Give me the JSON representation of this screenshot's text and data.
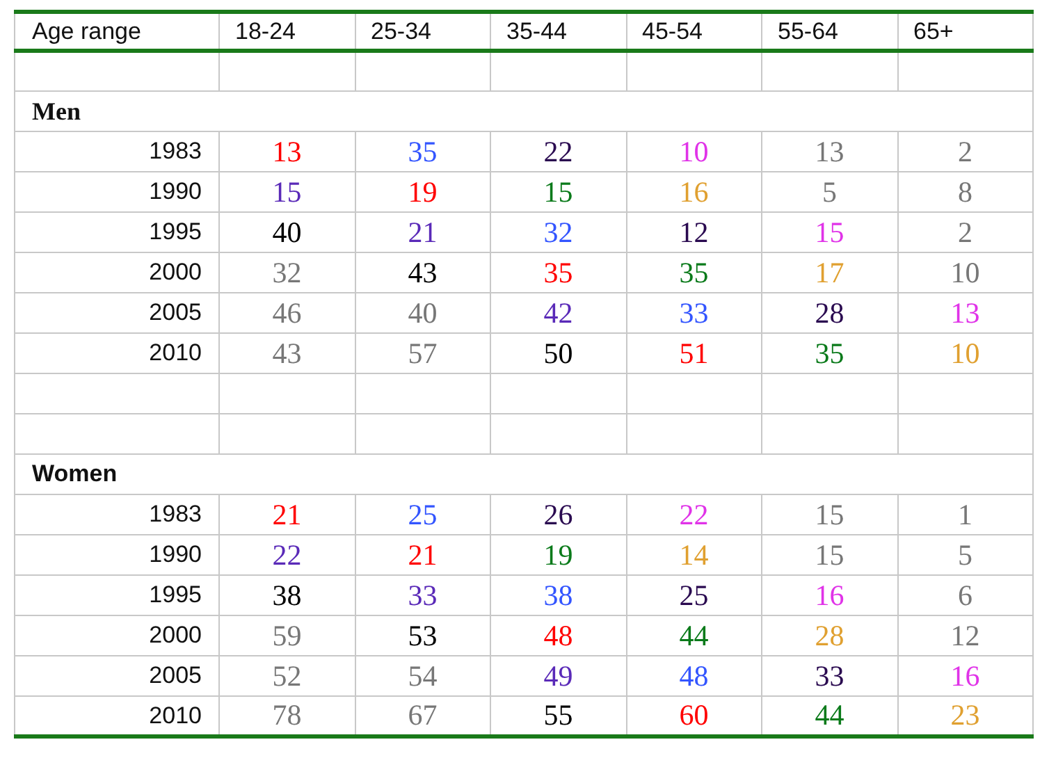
{
  "table": {
    "columns": [
      "Age range",
      "18-24",
      "25-34",
      "35-44",
      "45-54",
      "55-64",
      "65+"
    ],
    "rows": [
      {
        "kind": "blank"
      },
      {
        "kind": "group",
        "label": "Men"
      },
      {
        "kind": "data",
        "year": "1983",
        "cells": [
          {
            "value": "13",
            "color": "#ff0000"
          },
          {
            "value": "35",
            "color": "#3355ff"
          },
          {
            "value": "22",
            "color": "#2a0a50"
          },
          {
            "value": "10",
            "color": "#e033e8"
          },
          {
            "value": "13",
            "color": "#777777"
          },
          {
            "value": "2",
            "color": "#777777"
          }
        ]
      },
      {
        "kind": "data",
        "year": "1990",
        "cells": [
          {
            "value": "15",
            "color": "#5a2ab8"
          },
          {
            "value": "19",
            "color": "#ff0000"
          },
          {
            "value": "15",
            "color": "#0a7a1a"
          },
          {
            "value": "16",
            "color": "#e0a030"
          },
          {
            "value": "5",
            "color": "#777777"
          },
          {
            "value": "8",
            "color": "#777777"
          }
        ]
      },
      {
        "kind": "data",
        "year": "1995",
        "cells": [
          {
            "value": "40",
            "color": "#000000"
          },
          {
            "value": "21",
            "color": "#5a2ab8"
          },
          {
            "value": "32",
            "color": "#3355ff"
          },
          {
            "value": "12",
            "color": "#2a0a50"
          },
          {
            "value": "15",
            "color": "#e033e8"
          },
          {
            "value": "2",
            "color": "#777777"
          }
        ]
      },
      {
        "kind": "data",
        "year": "2000",
        "cells": [
          {
            "value": "32",
            "color": "#777777"
          },
          {
            "value": "43",
            "color": "#000000"
          },
          {
            "value": "35",
            "color": "#ff0000"
          },
          {
            "value": "35",
            "color": "#0a7a1a"
          },
          {
            "value": "17",
            "color": "#e0a030"
          },
          {
            "value": "10",
            "color": "#777777"
          }
        ]
      },
      {
        "kind": "data",
        "year": "2005",
        "cells": [
          {
            "value": "46",
            "color": "#777777"
          },
          {
            "value": "40",
            "color": "#777777"
          },
          {
            "value": "42",
            "color": "#5a2ab8"
          },
          {
            "value": "33",
            "color": "#3355ff"
          },
          {
            "value": "28",
            "color": "#2a0a50"
          },
          {
            "value": "13",
            "color": "#e033e8"
          }
        ]
      },
      {
        "kind": "data",
        "year": "2010",
        "cells": [
          {
            "value": "43",
            "color": "#777777"
          },
          {
            "value": "57",
            "color": "#777777"
          },
          {
            "value": "50",
            "color": "#000000"
          },
          {
            "value": "51",
            "color": "#ff0000"
          },
          {
            "value": "35",
            "color": "#0a7a1a"
          },
          {
            "value": "10",
            "color": "#e0a030"
          }
        ]
      },
      {
        "kind": "blank"
      },
      {
        "kind": "blank"
      },
      {
        "kind": "group",
        "label": "Women"
      },
      {
        "kind": "data",
        "year": "1983",
        "cells": [
          {
            "value": "21",
            "color": "#ff0000"
          },
          {
            "value": "25",
            "color": "#3355ff"
          },
          {
            "value": "26",
            "color": "#2a0a50"
          },
          {
            "value": "22",
            "color": "#e033e8"
          },
          {
            "value": "15",
            "color": "#777777"
          },
          {
            "value": "1",
            "color": "#777777"
          }
        ]
      },
      {
        "kind": "data",
        "year": "1990",
        "cells": [
          {
            "value": "22",
            "color": "#5a2ab8"
          },
          {
            "value": "21",
            "color": "#ff0000"
          },
          {
            "value": "19",
            "color": "#0a7a1a"
          },
          {
            "value": "14",
            "color": "#e0a030"
          },
          {
            "value": "15",
            "color": "#777777"
          },
          {
            "value": "5",
            "color": "#777777"
          }
        ]
      },
      {
        "kind": "data",
        "year": "1995",
        "cells": [
          {
            "value": "38",
            "color": "#000000"
          },
          {
            "value": "33",
            "color": "#5a2ab8"
          },
          {
            "value": "38",
            "color": "#3355ff"
          },
          {
            "value": "25",
            "color": "#2a0a50"
          },
          {
            "value": "16",
            "color": "#e033e8"
          },
          {
            "value": "6",
            "color": "#777777"
          }
        ]
      },
      {
        "kind": "data",
        "year": "2000",
        "cells": [
          {
            "value": "59",
            "color": "#777777"
          },
          {
            "value": "53",
            "color": "#000000"
          },
          {
            "value": "48",
            "color": "#ff0000"
          },
          {
            "value": "44",
            "color": "#0a7a1a"
          },
          {
            "value": "28",
            "color": "#e0a030"
          },
          {
            "value": "12",
            "color": "#777777"
          }
        ]
      },
      {
        "kind": "data",
        "year": "2005",
        "cells": [
          {
            "value": "52",
            "color": "#777777"
          },
          {
            "value": "54",
            "color": "#777777"
          },
          {
            "value": "49",
            "color": "#5a2ab8"
          },
          {
            "value": "48",
            "color": "#3355ff"
          },
          {
            "value": "33",
            "color": "#2a0a50"
          },
          {
            "value": "16",
            "color": "#e033e8"
          }
        ]
      },
      {
        "kind": "data",
        "year": "2010",
        "cells": [
          {
            "value": "78",
            "color": "#777777"
          },
          {
            "value": "67",
            "color": "#777777"
          },
          {
            "value": "55",
            "color": "#000000"
          },
          {
            "value": "60",
            "color": "#ff0000"
          },
          {
            "value": "44",
            "color": "#0a7a1a"
          },
          {
            "value": "23",
            "color": "#e0a030"
          }
        ]
      }
    ]
  }
}
